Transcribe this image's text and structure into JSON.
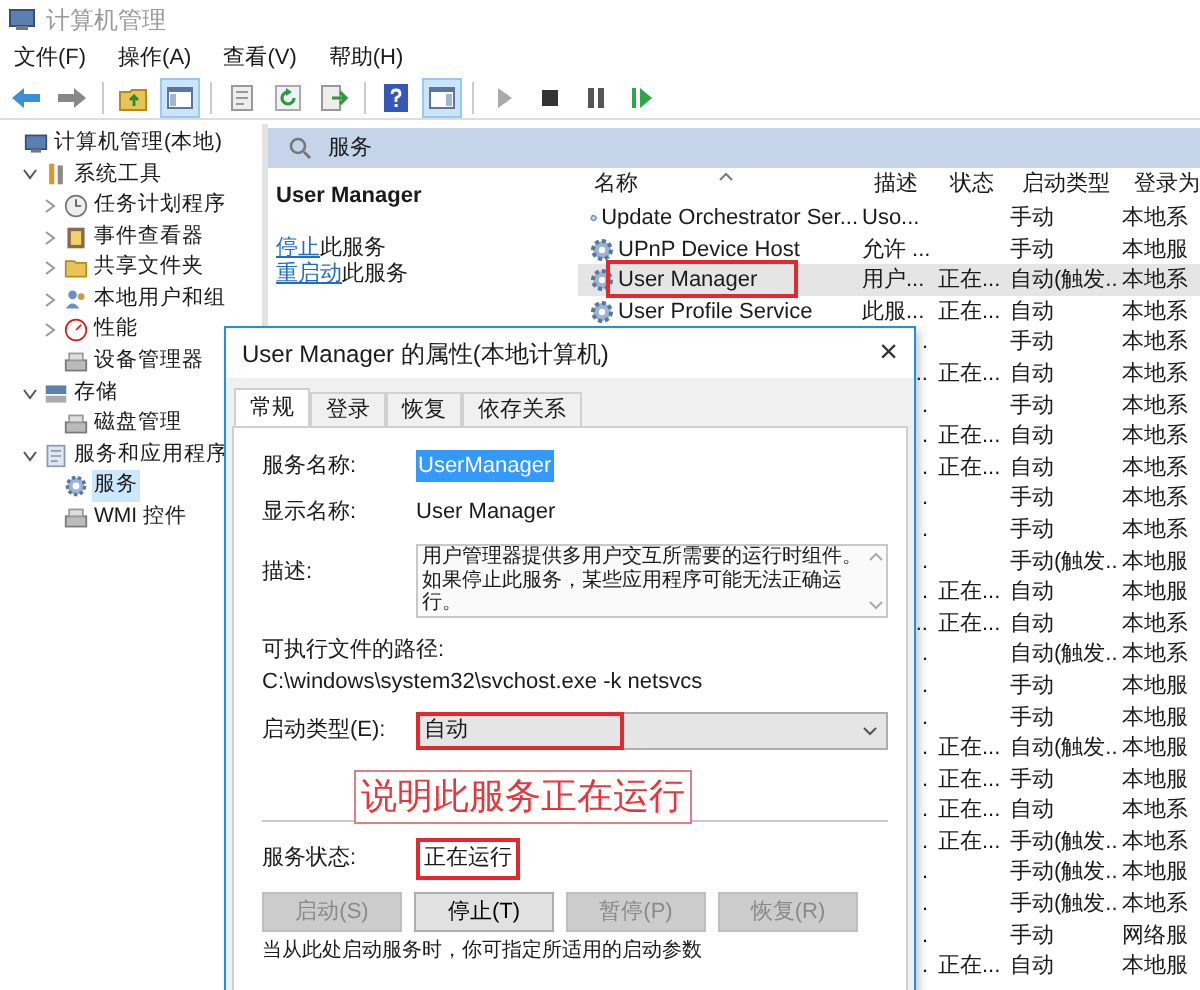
{
  "window": {
    "title": "计算机管理"
  },
  "menu": [
    "文件(F)",
    "操作(A)",
    "查看(V)",
    "帮助(H)"
  ],
  "toolbar": [
    {
      "kind": "back",
      "pressed": false
    },
    {
      "kind": "forward",
      "pressed": false
    },
    {
      "kind": "sep"
    },
    {
      "kind": "up",
      "pressed": false
    },
    {
      "kind": "tree",
      "pressed": true
    },
    {
      "kind": "sep"
    },
    {
      "kind": "props",
      "pressed": false
    },
    {
      "kind": "refresh",
      "pressed": false
    },
    {
      "kind": "export",
      "pressed": false
    },
    {
      "kind": "sep"
    },
    {
      "kind": "help",
      "pressed": false
    },
    {
      "kind": "pane",
      "pressed": true
    },
    {
      "kind": "sep"
    },
    {
      "kind": "play",
      "pressed": false
    },
    {
      "kind": "stop",
      "pressed": false
    },
    {
      "kind": "pause",
      "pressed": false
    },
    {
      "kind": "resume",
      "pressed": false
    }
  ],
  "tree": [
    {
      "label": "计算机管理(本地)",
      "kind": "computer",
      "selected": false,
      "children": [
        {
          "label": "系统工具",
          "kind": "tools",
          "selected": false,
          "expanded": true,
          "children": [
            {
              "label": "任务计划程序",
              "kind": "clock",
              "selected": false,
              "expanded": false
            },
            {
              "label": "事件查看器",
              "kind": "log",
              "selected": false,
              "expanded": false
            },
            {
              "label": "共享文件夹",
              "kind": "folder",
              "selected": false,
              "expanded": false
            },
            {
              "label": "本地用户和组",
              "kind": "users",
              "selected": false,
              "expanded": false
            },
            {
              "label": "性能",
              "kind": "perf",
              "selected": false,
              "expanded": false
            },
            {
              "label": "设备管理器",
              "kind": "device",
              "selected": false
            }
          ]
        },
        {
          "label": "存储",
          "kind": "storage",
          "selected": false,
          "expanded": true,
          "children": [
            {
              "label": "磁盘管理",
              "kind": "device",
              "selected": false
            }
          ]
        },
        {
          "label": "服务和应用程序",
          "kind": "apps",
          "selected": false,
          "expanded": true,
          "children": [
            {
              "label": "服务",
              "kind": "gear",
              "selected": true
            },
            {
              "label": "WMI 控件",
              "kind": "device",
              "selected": false
            }
          ]
        }
      ]
    }
  ],
  "services_header": {
    "title": "服务"
  },
  "action_pane": {
    "title": "User Manager",
    "actions": [
      {
        "link": "停止",
        "text": "此服务"
      },
      {
        "link": "重启动",
        "text": "此服务"
      }
    ]
  },
  "table": {
    "columns": [
      "名称",
      "描述",
      "状态",
      "启动类型",
      "登录为"
    ],
    "rows": [
      {
        "name": "Update Orchestrator Ser...",
        "description": "Uso...",
        "status": "",
        "startup": "手动",
        "login": "本地系",
        "selected": false,
        "highlighted": false
      },
      {
        "name": "UPnP Device Host",
        "description": "允许 ...",
        "status": "",
        "startup": "手动",
        "login": "本地服",
        "selected": false,
        "highlighted": false
      },
      {
        "name": "User Manager",
        "description": "用户...",
        "status": "正在...",
        "startup": "自动(触发...",
        "login": "本地系",
        "selected": true,
        "highlighted": true
      },
      {
        "name": "User Profile Service",
        "description": "此服...",
        "status": "正在...",
        "startup": "自动",
        "login": "本地系",
        "selected": false,
        "highlighted": false
      },
      {
        "description": ".",
        "status": "",
        "startup": "手动",
        "login": "本地系",
        "selected": false,
        "highlighted": false
      },
      {
        "description": "..",
        "status": "正在...",
        "startup": "自动",
        "login": "本地系",
        "selected": false,
        "highlighted": false
      },
      {
        "description": ".",
        "status": "",
        "startup": "手动",
        "login": "本地系",
        "selected": false,
        "highlighted": false
      },
      {
        "description": ".",
        "status": "正在...",
        "startup": "自动",
        "login": "本地系",
        "selected": false,
        "highlighted": false
      },
      {
        "description": ".",
        "status": "正在...",
        "startup": "自动",
        "login": "本地系",
        "selected": false,
        "highlighted": false
      },
      {
        "description": ".",
        "status": "",
        "startup": "手动",
        "login": "本地系",
        "selected": false,
        "highlighted": false
      },
      {
        "description": ".",
        "status": "",
        "startup": "手动",
        "login": "本地系",
        "selected": false,
        "highlighted": false
      },
      {
        "description": ".",
        "status": "",
        "startup": "手动(触发...",
        "login": "本地服",
        "selected": false,
        "highlighted": false
      },
      {
        "description": ".",
        "status": "正在...",
        "startup": "自动",
        "login": "本地服",
        "selected": false,
        "highlighted": false
      },
      {
        "description": "..",
        "status": "正在...",
        "startup": "自动",
        "login": "本地系",
        "selected": false,
        "highlighted": false
      },
      {
        "description": ".",
        "status": "",
        "startup": "自动(触发...",
        "login": "本地系",
        "selected": false,
        "highlighted": false
      },
      {
        "description": ".",
        "status": "",
        "startup": "手动",
        "login": "本地服",
        "selected": false,
        "highlighted": false
      },
      {
        "description": ".",
        "status": "",
        "startup": "手动",
        "login": "本地服",
        "selected": false,
        "highlighted": false
      },
      {
        "description": ".",
        "status": "正在...",
        "startup": "自动(触发...",
        "login": "本地服",
        "selected": false,
        "highlighted": false
      },
      {
        "description": ".",
        "status": "正在...",
        "startup": "手动",
        "login": "本地服",
        "selected": false,
        "highlighted": false
      },
      {
        "description": ".",
        "status": "正在...",
        "startup": "自动",
        "login": "本地系",
        "selected": false,
        "highlighted": false
      },
      {
        "description": ".",
        "status": "正在...",
        "startup": "手动(触发...",
        "login": "本地系",
        "selected": false,
        "highlighted": false
      },
      {
        "description": ".",
        "status": "",
        "startup": "手动(触发...",
        "login": "本地服",
        "selected": false,
        "highlighted": false
      },
      {
        "description": ".",
        "status": "",
        "startup": "手动(触发...",
        "login": "本地系",
        "selected": false,
        "highlighted": false
      },
      {
        "description": ".",
        "status": "",
        "startup": "手动",
        "login": "网络服",
        "selected": false,
        "highlighted": false
      },
      {
        "description": ".",
        "status": "正在...",
        "startup": "自动",
        "login": "本地服",
        "selected": false,
        "highlighted": false
      }
    ]
  },
  "dialog": {
    "title": "User Manager 的属性(本地计算机)",
    "close": "×",
    "tabs": [
      {
        "label": "常规",
        "selected": true
      },
      {
        "label": "登录",
        "selected": false
      },
      {
        "label": "恢复",
        "selected": false
      },
      {
        "label": "依存关系",
        "selected": false
      }
    ],
    "service_name": {
      "label": "服务名称:",
      "value": "UserManager"
    },
    "display_name": {
      "label": "显示名称:",
      "value": "User Manager"
    },
    "description": {
      "label": "描述:",
      "value": "用户管理器提供多用户交互所需要的运行时组件。如果停止此服务，某些应用程序可能无法正确运行。"
    },
    "path": {
      "label": "可执行文件的路径:",
      "value": "C:\\windows\\system32\\svchost.exe -k netsvcs"
    },
    "startup_type": {
      "label": "启动类型(E):",
      "value": "自动",
      "highlighted": true
    },
    "annotation": "说明此服务正在运行",
    "service_status": {
      "label": "服务状态:",
      "value": "正在运行",
      "highlighted": true
    },
    "buttons": [
      {
        "label": "启动(S)",
        "disabled": true
      },
      {
        "label": "停止(T)",
        "disabled": false
      },
      {
        "label": "暂停(P)",
        "disabled": true
      },
      {
        "label": "恢复(R)",
        "disabled": true
      }
    ],
    "hint": "当从此处启动服务时，你可指定所适用的启动参数"
  }
}
